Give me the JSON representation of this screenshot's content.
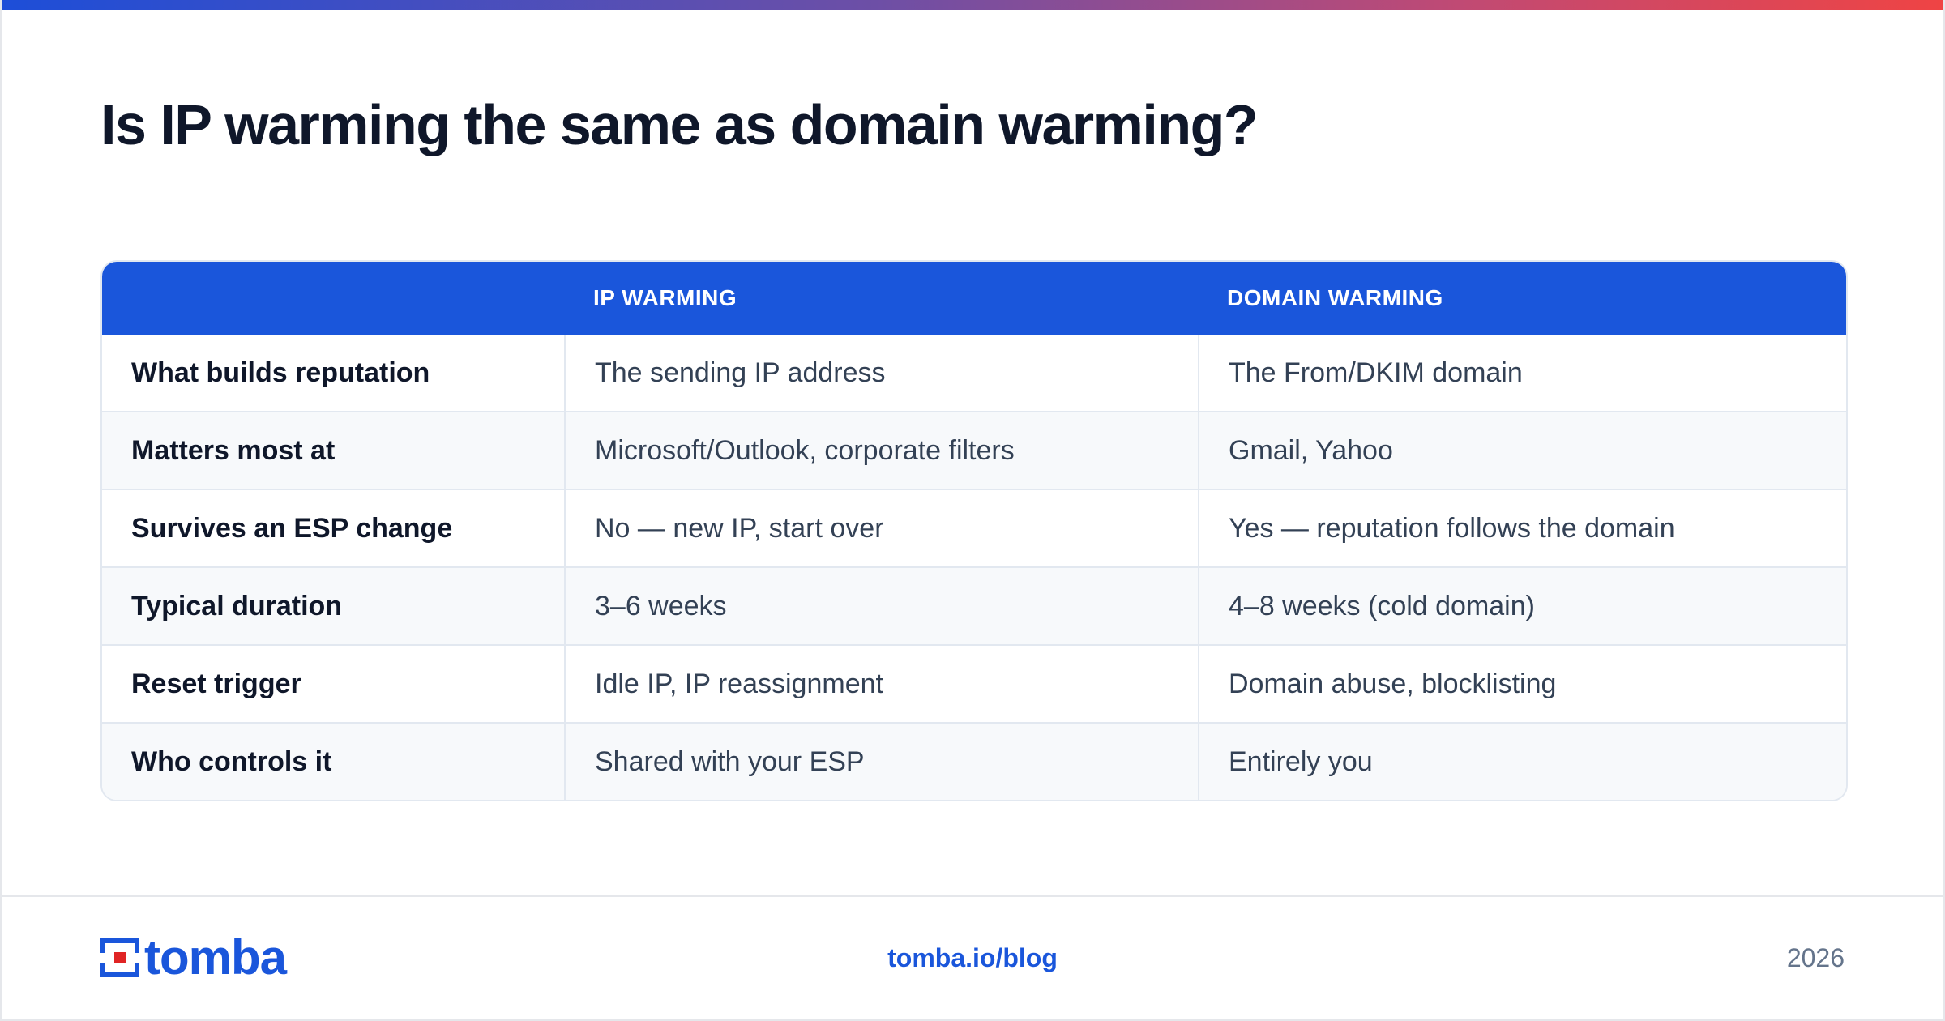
{
  "title": "Is IP warming the same as domain warming?",
  "table": {
    "headers": [
      "",
      "IP WARMING",
      "DOMAIN WARMING"
    ],
    "rows": [
      {
        "label": "What builds reputation",
        "ip": "The sending IP address",
        "domain": "The From/DKIM domain"
      },
      {
        "label": "Matters most at",
        "ip": "Microsoft/Outlook, corporate filters",
        "domain": "Gmail, Yahoo"
      },
      {
        "label": "Survives an ESP change",
        "ip": "No — new IP, start over",
        "domain": "Yes — reputation follows the domain"
      },
      {
        "label": "Typical duration",
        "ip": "3–6 weeks",
        "domain": "4–8 weeks (cold domain)"
      },
      {
        "label": "Reset trigger",
        "ip": "Idle IP, IP reassignment",
        "domain": "Domain abuse, blocklisting"
      },
      {
        "label": "Who controls it",
        "ip": "Shared with your ESP",
        "domain": "Entirely you"
      }
    ]
  },
  "footer": {
    "logo_text": "tomba",
    "url": "tomba.io/blog",
    "year": "2026"
  },
  "colors": {
    "accent": "#1a56db",
    "logo_red": "#e02424",
    "header_bg": "#1a56db",
    "alt_row_bg": "#f7f9fb"
  }
}
